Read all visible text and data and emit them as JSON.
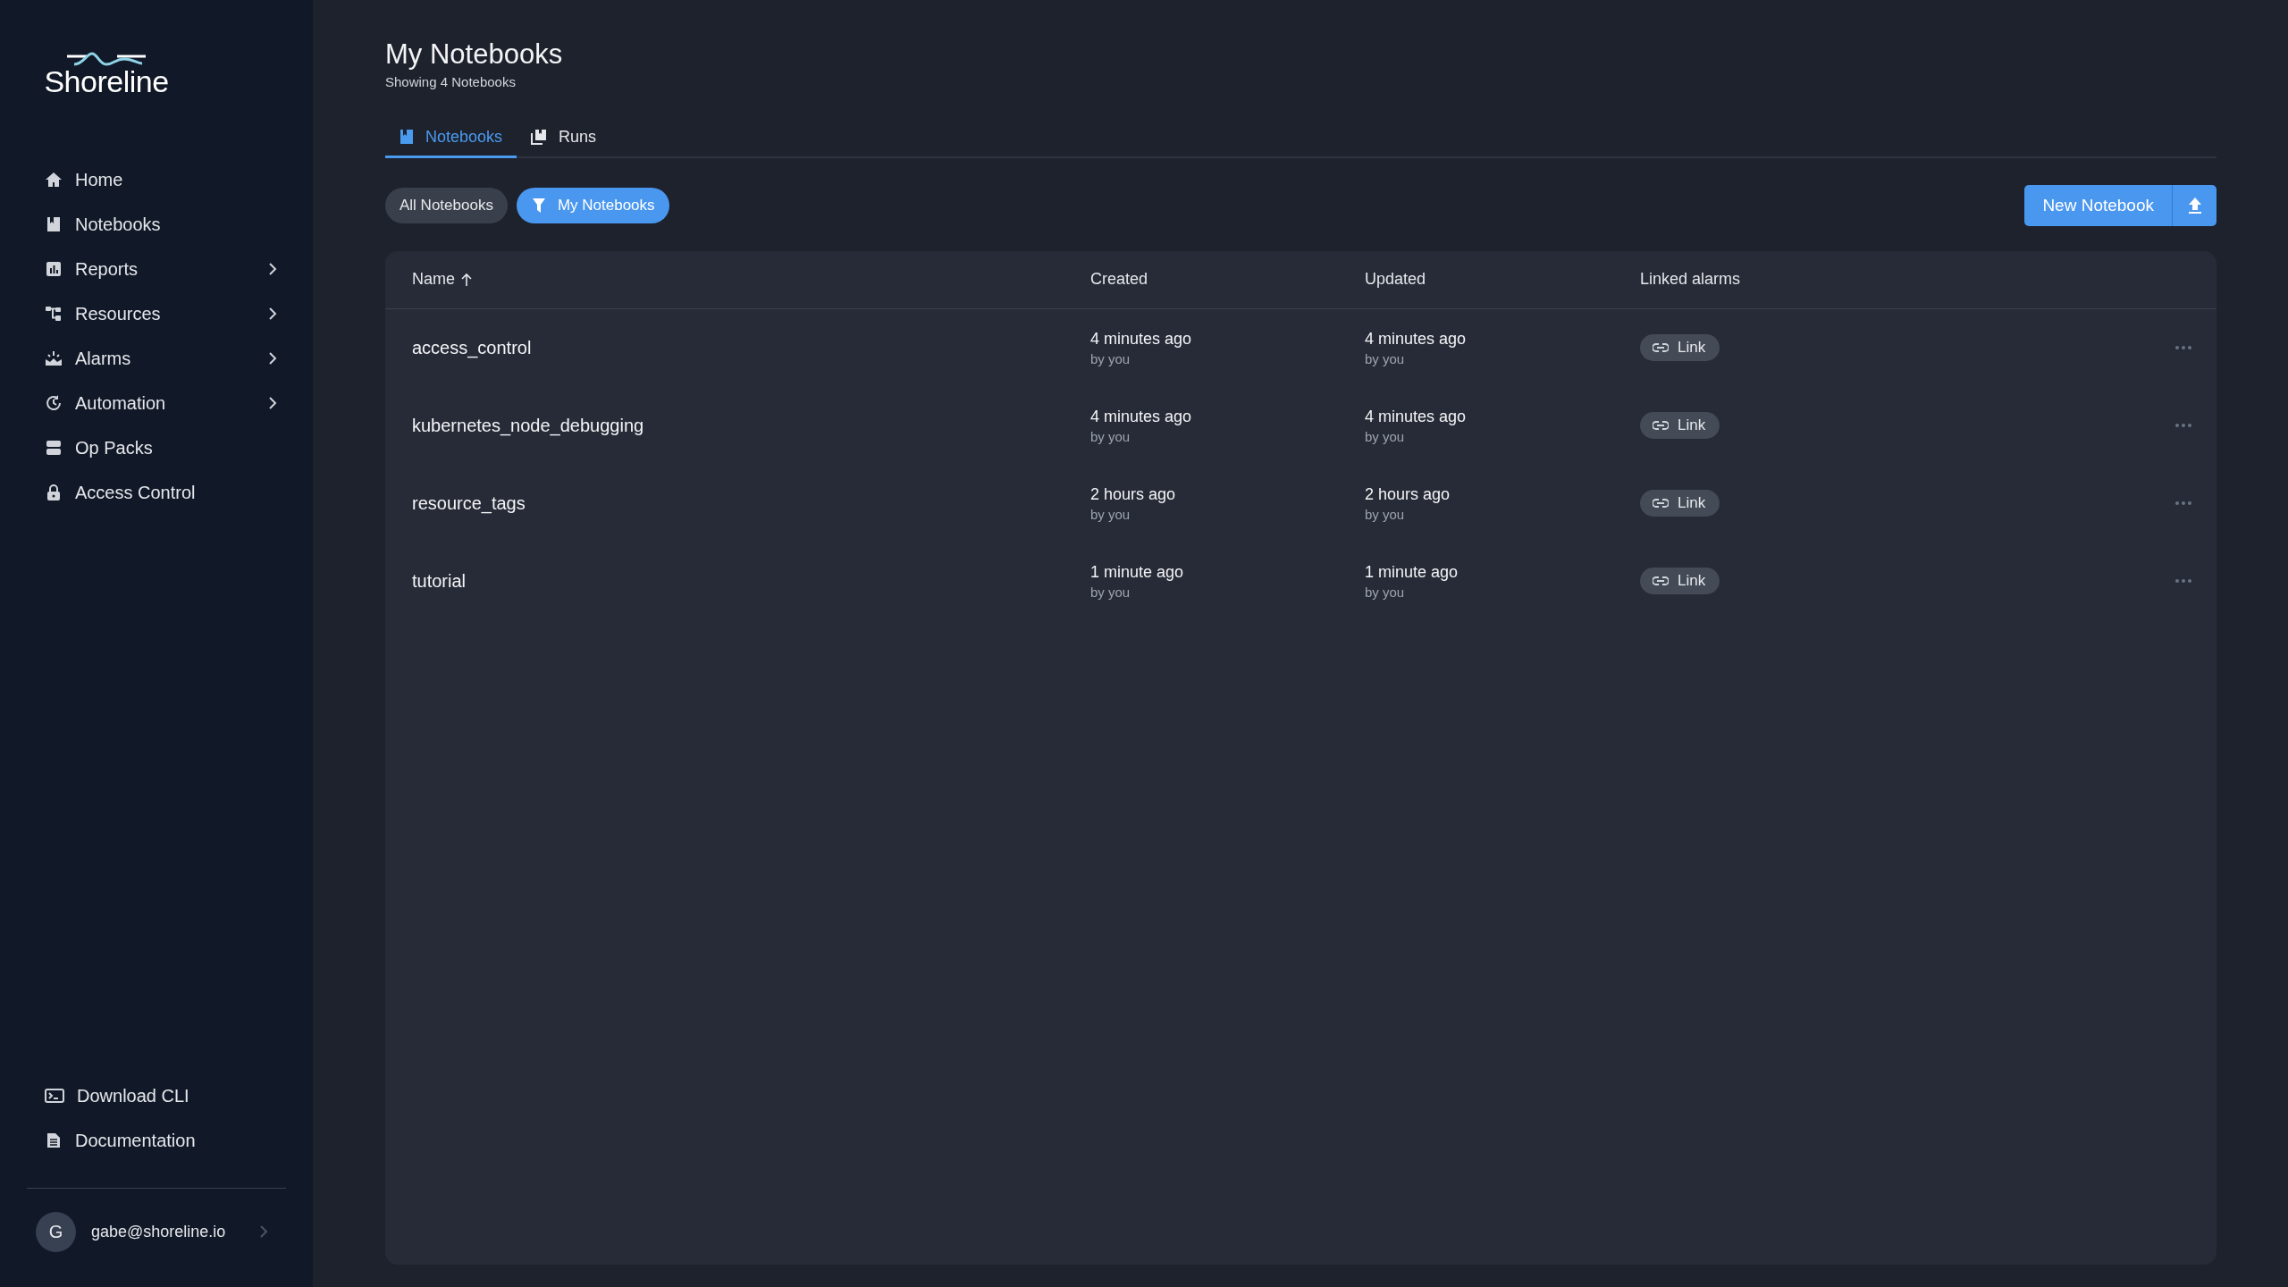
{
  "brand": {
    "name": "Shoreline"
  },
  "sidebar": {
    "items": [
      {
        "label": "Home",
        "expandable": false
      },
      {
        "label": "Notebooks",
        "expandable": false
      },
      {
        "label": "Reports",
        "expandable": true
      },
      {
        "label": "Resources",
        "expandable": true
      },
      {
        "label": "Alarms",
        "expandable": true
      },
      {
        "label": "Automation",
        "expandable": true
      },
      {
        "label": "Op Packs",
        "expandable": false
      },
      {
        "label": "Access Control",
        "expandable": false
      }
    ],
    "footer_items": [
      {
        "label": "Download CLI"
      },
      {
        "label": "Documentation"
      }
    ],
    "user": {
      "initial": "G",
      "email": "gabe@shoreline.io"
    }
  },
  "page": {
    "title": "My Notebooks",
    "subtitle": "Showing 4 Notebooks"
  },
  "tabs": [
    {
      "label": "Notebooks",
      "selected": true
    },
    {
      "label": "Runs",
      "selected": false
    }
  ],
  "filters": [
    {
      "label": "All Notebooks",
      "selected": false
    },
    {
      "label": "My Notebooks",
      "selected": true
    }
  ],
  "new_button": {
    "label": "New Notebook"
  },
  "table": {
    "columns": [
      {
        "label": "Name",
        "sorted_ascending": true
      },
      {
        "label": "Created",
        "sorted_ascending": false
      },
      {
        "label": "Updated",
        "sorted_ascending": false
      },
      {
        "label": "Linked alarms",
        "sorted_ascending": false
      }
    ],
    "rows": [
      {
        "name": "access_control",
        "created": "4 minutes ago",
        "created_by": "by you",
        "updated": "4 minutes ago",
        "updated_by": "by you",
        "link": "Link"
      },
      {
        "name": "kubernetes_node_debugging",
        "created": "4 minutes ago",
        "created_by": "by you",
        "updated": "4 minutes ago",
        "updated_by": "by you",
        "link": "Link"
      },
      {
        "name": "resource_tags",
        "created": "2 hours ago",
        "created_by": "by you",
        "updated": "2 hours ago",
        "updated_by": "by you",
        "link": "Link"
      },
      {
        "name": "tutorial",
        "created": "1 minute ago",
        "created_by": "by you",
        "updated": "1 minute ago",
        "updated_by": "by you",
        "link": "Link"
      }
    ]
  }
}
